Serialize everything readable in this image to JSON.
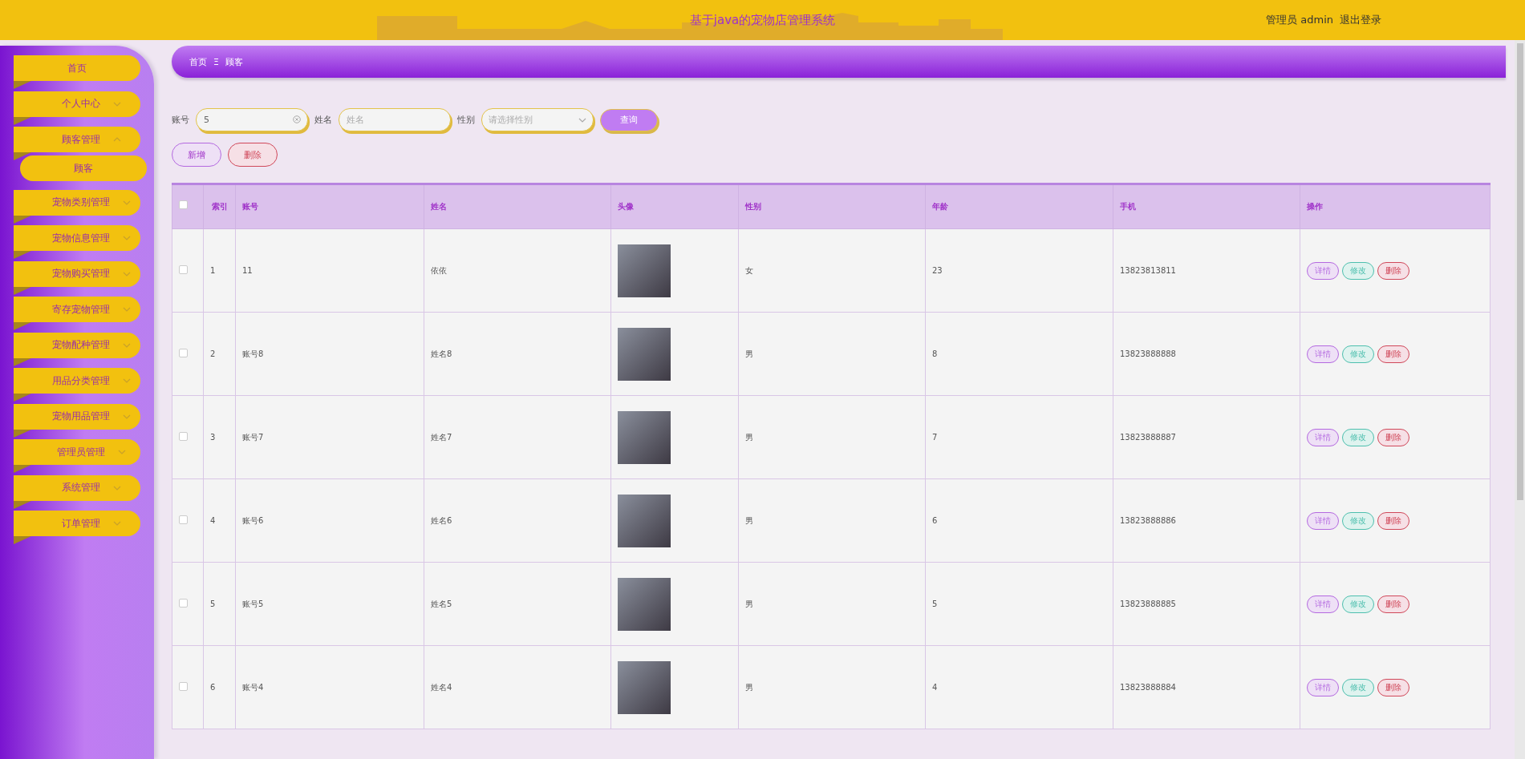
{
  "header": {
    "title": "基于java的宠物店管理系统",
    "user_role": "管理员",
    "user_name": "admin",
    "logout": "退出登录"
  },
  "sidebar": {
    "items": [
      {
        "label": "首页",
        "kind": "link"
      },
      {
        "label": "个人中心",
        "kind": "menu",
        "expanded": false
      },
      {
        "label": "顾客管理",
        "kind": "menu",
        "expanded": true,
        "children": [
          {
            "label": "顾客"
          }
        ]
      },
      {
        "label": "宠物类别管理",
        "kind": "menu",
        "expanded": false
      },
      {
        "label": "宠物信息管理",
        "kind": "menu",
        "expanded": false
      },
      {
        "label": "宠物购买管理",
        "kind": "menu",
        "expanded": false
      },
      {
        "label": "寄存宠物管理",
        "kind": "menu",
        "expanded": false
      },
      {
        "label": "宠物配种管理",
        "kind": "menu",
        "expanded": false
      },
      {
        "label": "用品分类管理",
        "kind": "menu",
        "expanded": false
      },
      {
        "label": "宠物用品管理",
        "kind": "menu",
        "expanded": false
      },
      {
        "label": "管理员管理",
        "kind": "menu",
        "expanded": false
      },
      {
        "label": "系统管理",
        "kind": "menu",
        "expanded": false
      },
      {
        "label": "订单管理",
        "kind": "menu",
        "expanded": false
      }
    ]
  },
  "breadcrumb": {
    "items": [
      "首页",
      "顾客"
    ],
    "separator": "Ξ"
  },
  "search": {
    "fields": [
      {
        "label": "账号",
        "kind": "text",
        "value": "5",
        "clearable": true
      },
      {
        "label": "姓名",
        "kind": "text",
        "placeholder": "姓名"
      },
      {
        "label": "性别",
        "kind": "select",
        "placeholder": "请选择性别"
      }
    ],
    "button": "查询"
  },
  "actions": [
    {
      "label": "新增",
      "kind": "add"
    },
    {
      "label": "删除",
      "kind": "delete"
    }
  ],
  "table": {
    "select_all_checked": false,
    "columns": [
      "索引",
      "账号",
      "姓名",
      "头像",
      "性别",
      "年龄",
      "手机",
      "操作"
    ],
    "rows": [
      {
        "checked": false,
        "index": "1",
        "account": "11",
        "name": "依依",
        "gender": "女",
        "age": "23",
        "phone": "13823813811",
        "actions": [
          "详情",
          "修改",
          "删除"
        ]
      },
      {
        "checked": false,
        "index": "2",
        "account": "账号8",
        "name": "姓名8",
        "gender": "男",
        "age": "8",
        "phone": "13823888888",
        "actions": [
          "详情",
          "修改",
          "删除"
        ]
      },
      {
        "checked": false,
        "index": "3",
        "account": "账号7",
        "name": "姓名7",
        "gender": "男",
        "age": "7",
        "phone": "13823888887",
        "actions": [
          "详情",
          "修改",
          "删除"
        ]
      },
      {
        "checked": false,
        "index": "4",
        "account": "账号6",
        "name": "姓名6",
        "gender": "男",
        "age": "6",
        "phone": "13823888886",
        "actions": [
          "详情",
          "修改",
          "删除"
        ]
      },
      {
        "checked": false,
        "index": "5",
        "account": "账号5",
        "name": "姓名5",
        "gender": "男",
        "age": "5",
        "phone": "13823888885",
        "actions": [
          "详情",
          "修改",
          "删除"
        ]
      },
      {
        "checked": false,
        "index": "6",
        "account": "账号4",
        "name": "姓名4",
        "gender": "男",
        "age": "4",
        "phone": "13823888884",
        "actions": [
          "详情",
          "修改",
          "删除"
        ]
      }
    ]
  }
}
